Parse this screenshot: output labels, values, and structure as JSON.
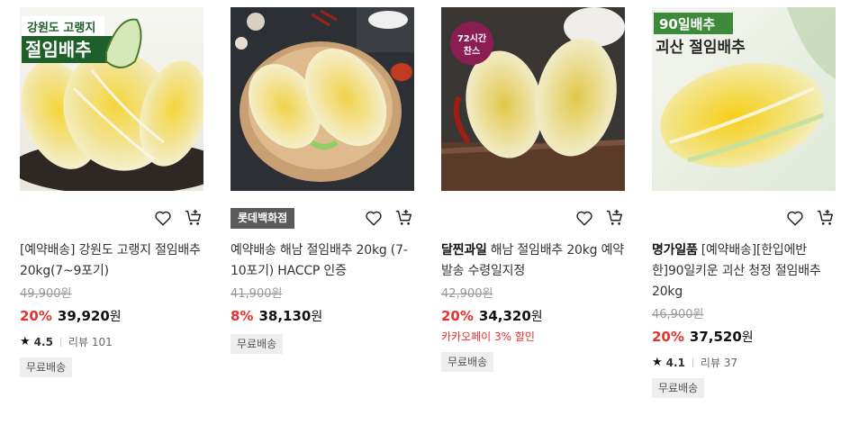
{
  "products": [
    {
      "image_caption": {
        "line1": "강원도 고랭지",
        "line2": "절임배추"
      },
      "store_chip": "",
      "brand": "",
      "title": "[예약배송] 강원도 고랭지 절임배추 20kg(7~9포기)",
      "original_price": "49,900원",
      "discount": "20%",
      "price": "39,920",
      "currency": "원",
      "promo": "",
      "rating": "4.5",
      "reviews": "리뷰 101",
      "badge": "무료배송"
    },
    {
      "image_caption": {},
      "store_chip": "롯데백화점",
      "brand": "",
      "title": "예약배송 해남 절임배추 20kg (7-10포기) HACCP 인증",
      "original_price": "41,900원",
      "discount": "8%",
      "price": "38,130",
      "currency": "원",
      "promo": "",
      "rating": "",
      "reviews": "",
      "badge": "무료배송"
    },
    {
      "image_caption": {
        "line1": "72시간",
        "line2": "찬스"
      },
      "store_chip": "",
      "brand": "달찐과일",
      "title": "해남 절임배추 20kg 예약발송 수령일지정",
      "original_price": "42,900원",
      "discount": "20%",
      "price": "34,320",
      "currency": "원",
      "promo": "카카오페이 3% 할인",
      "rating": "",
      "reviews": "",
      "badge": "무료배송"
    },
    {
      "image_caption": {
        "line1": "90일배추",
        "line2": "괴산 절임배추"
      },
      "store_chip": "",
      "brand": "명가일품",
      "title": "[예약배송][한입에반한]90일키운 괴산 청정 절임배추 20kg",
      "original_price": "46,900원",
      "discount": "20%",
      "price": "37,520",
      "currency": "원",
      "promo": "",
      "rating": "4.1",
      "reviews": "리뷰 37",
      "badge": "무료배송"
    }
  ],
  "icons": {
    "wishlist": "heart-outline-icon",
    "cart": "cart-plus-icon",
    "rating": "star-icon"
  },
  "colors": {
    "discount": "#e8312f",
    "chip": "#5a5a5a",
    "badge_bg": "#eeeeee"
  }
}
